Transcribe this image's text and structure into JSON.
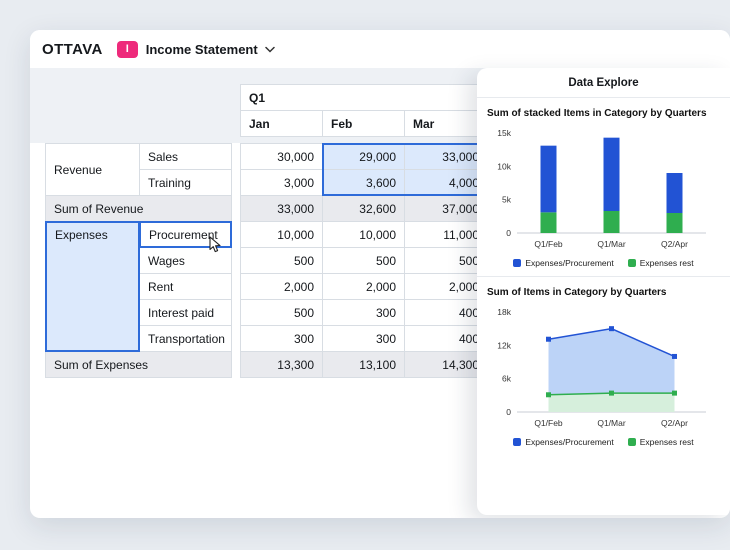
{
  "header": {
    "logo": "OTTAVA",
    "doc_badge": "I",
    "doc_title": "Income Statement"
  },
  "colors": {
    "accent_pink": "#ee2a7b",
    "chart_blue": "#2253d4",
    "chart_green": "#2fae4f",
    "selection_fill": "#dce9fc",
    "selection_border": "#2e6bd9",
    "summary_bg": "#e9eaee",
    "grid_border": "#d8dde3",
    "panel_band": "#eef1f5"
  },
  "table": {
    "quarter_header": "Q1",
    "month_headers": [
      "Jan",
      "Feb",
      "Mar"
    ],
    "rows": [
      {
        "category": "Revenue",
        "item": "Sales",
        "values": [
          "30,000",
          "29,000",
          "33,000"
        ]
      },
      {
        "item": "Training",
        "values": [
          "3,000",
          "3,600",
          "4,000"
        ]
      },
      {
        "summary": "Sum of Revenue",
        "values": [
          "33,000",
          "32,600",
          "37,000"
        ]
      },
      {
        "category": "Expenses",
        "item": "Procurement",
        "values": [
          "10,000",
          "10,000",
          "11,000"
        ]
      },
      {
        "item": "Wages",
        "values": [
          "500",
          "500",
          "500"
        ]
      },
      {
        "item": "Rent",
        "values": [
          "2,000",
          "2,000",
          "2,000"
        ]
      },
      {
        "item": "Interest paid",
        "values": [
          "500",
          "300",
          "400"
        ]
      },
      {
        "item": "Transportation",
        "values": [
          "300",
          "300",
          "400"
        ]
      },
      {
        "summary": "Sum of Expenses",
        "values": [
          "13,300",
          "13,100",
          "14,300"
        ]
      }
    ]
  },
  "panel": {
    "title": "Data Explore"
  },
  "chart_data": [
    {
      "type": "bar",
      "stacked": true,
      "title": "Sum of stacked Items in Category by Quarters",
      "categories": [
        "Q1/Feb",
        "Q1/Mar",
        "Q2/Apr"
      ],
      "series": [
        {
          "name": "Expenses/Procurement",
          "color": "#2253d4",
          "values": [
            10000,
            11000,
            6000
          ]
        },
        {
          "name": "Expenses rest",
          "color": "#2fae4f",
          "values": [
            3100,
            3300,
            3000
          ]
        }
      ],
      "ylim": [
        0,
        15000
      ],
      "yticks": [
        "0",
        "5k",
        "10k",
        "15k"
      ],
      "legend_position": "bottom",
      "grid": false
    },
    {
      "type": "area",
      "title": "Sum of Items in Category by Quarters",
      "categories": [
        "Q1/Feb",
        "Q1/Mar",
        "Q2/Apr"
      ],
      "series": [
        {
          "name": "Expenses/Procurement",
          "color": "#2253d4",
          "values": [
            13100,
            15000,
            10000
          ]
        },
        {
          "name": "Expenses rest",
          "color": "#2fae4f",
          "values": [
            3100,
            3400,
            3400
          ]
        }
      ],
      "ylim": [
        0,
        18000
      ],
      "yticks": [
        "0",
        "6k",
        "12k",
        "18k"
      ],
      "legend_position": "bottom",
      "grid": false
    }
  ]
}
